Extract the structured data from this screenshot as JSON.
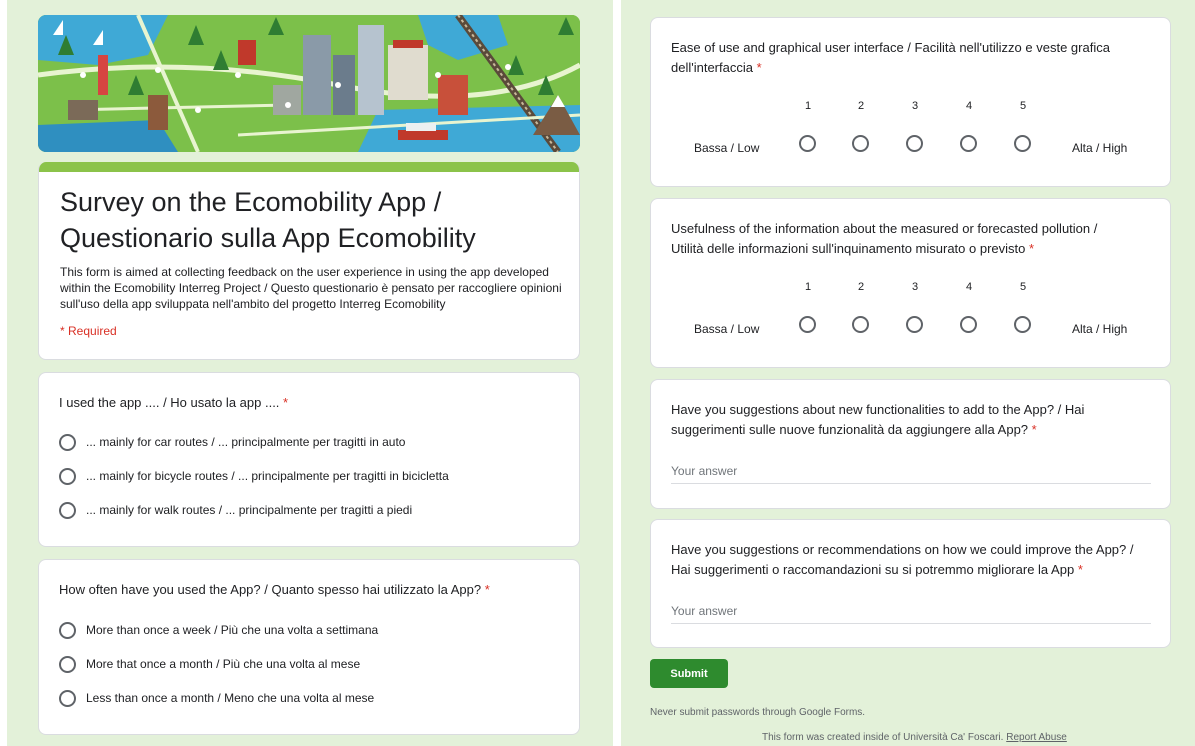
{
  "form": {
    "title": "Survey on the Ecomobility App / Questionario sulla App Ecomobility",
    "description": "This form is aimed at collecting feedback on the user experience in using the app developed within the Ecomobility Interreg Project / Questo questionario è pensato per raccogliere opinioni sull'uso della app sviluppata nell'ambito del progetto Interreg Ecomobility",
    "required_note": "* Required"
  },
  "colors": {
    "accent": "#8bc34a",
    "background": "#e3f1d9",
    "submit": "#2e8b2e",
    "required": "#d93025"
  },
  "questions": {
    "q1": {
      "title": "I used the app .... / Ho usato la app ....",
      "options": [
        "... mainly for car routes / ... principalmente per tragitti in auto",
        "... mainly for bicycle routes / ... principalmente per tragitti in bicicletta",
        "... mainly for walk routes / ... principalmente per tragitti a piedi"
      ]
    },
    "q2": {
      "title": "How often have you used the App? / Quanto spesso hai utilizzato la App?",
      "options": [
        "More than once a week / Più che una volta a settimana",
        "More that once a month / Più che una volta al mese",
        "Less than once a month / Meno che una volta al mese"
      ]
    },
    "q3": {
      "title_line1": "Ease of use and graphical user interface / Facilità nell'utilizzo e veste grafica",
      "title_line2": "dell'interfaccia",
      "scale": [
        "1",
        "2",
        "3",
        "4",
        "5"
      ],
      "low": "Bassa / Low",
      "high": "Alta / High"
    },
    "q4": {
      "title_line1": "Usefulness of the information about the measured or forecasted pollution /",
      "title_line2": "Utilità delle informazioni sull'inquinamento misurato o previsto",
      "scale": [
        "1",
        "2",
        "3",
        "4",
        "5"
      ],
      "low": "Bassa / Low",
      "high": "Alta / High"
    },
    "q5": {
      "title_line1": "Have you suggestions about new functionalities to add to the App? / Hai",
      "title_line2": "suggerimenti sulle nuove funzionalità da aggiungere alla App?",
      "placeholder": "Your answer"
    },
    "q6": {
      "title_line1": "Have you suggestions or recommendations on how we could improve the App? /",
      "title_line2": "Hai suggerimenti o raccomandazioni su si potremmo migliorare la App",
      "placeholder": "Your answer"
    }
  },
  "required_marker": "*",
  "submit_label": "Submit",
  "password_warning": "Never submit passwords through Google Forms.",
  "footer": {
    "text": "This form was created inside of Università Ca' Foscari.",
    "link": "Report Abuse"
  }
}
